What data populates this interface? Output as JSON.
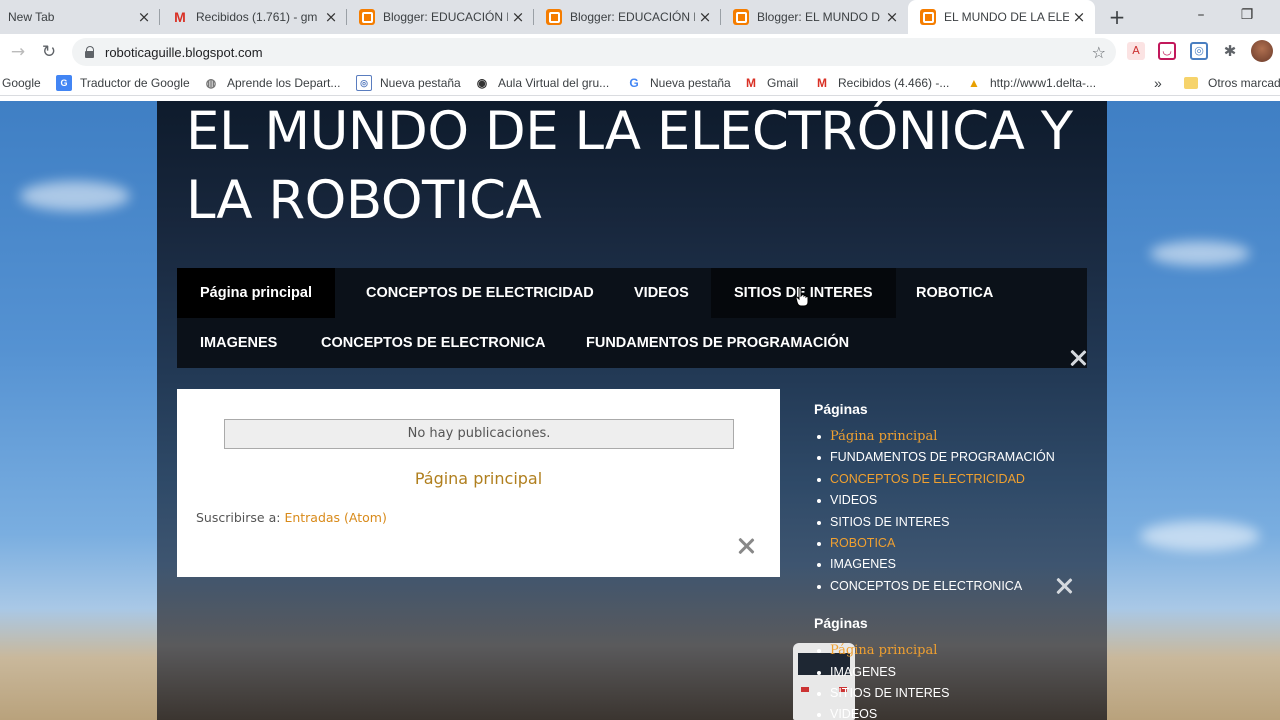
{
  "browser": {
    "tabs": [
      {
        "title": "New Tab",
        "favicon": "none"
      },
      {
        "title": "Recibidos (1.761) - gm",
        "favicon": "gmail-icon"
      },
      {
        "title": "Blogger: EDUCACIÓN D",
        "favicon": "blogger-icon"
      },
      {
        "title": "Blogger: EDUCACIÓN D",
        "favicon": "blogger-icon"
      },
      {
        "title": "Blogger: EL MUNDO D",
        "favicon": "blogger-icon"
      },
      {
        "title": "EL MUNDO DE LA ELEC",
        "favicon": "blogger-icon",
        "active": true
      }
    ],
    "new_tab": "+",
    "close_glyph": "×",
    "window_controls": {
      "minimize": "–",
      "restore": "❐"
    },
    "url": "roboticaguille.blogspot.com",
    "bookmarks": [
      {
        "label": "Google",
        "icon": "none"
      },
      {
        "label": "Traductor de Google",
        "icon": "translate-icon"
      },
      {
        "label": "Aprende los Depart...",
        "icon": "globe-icon"
      },
      {
        "label": "Nueva pestaña",
        "icon": "newtab-icon"
      },
      {
        "label": "Aula Virtual del gru...",
        "icon": "globe-icon"
      },
      {
        "label": "Nueva pestaña",
        "icon": "google-icon"
      },
      {
        "label": "Gmail",
        "icon": "gmail-icon"
      },
      {
        "label": "Recibidos (4.466) -...",
        "icon": "gmail-icon"
      },
      {
        "label": "http://www1.delta-...",
        "icon": "delta-icon"
      }
    ],
    "more_bookmarks": "»",
    "other_bookmarks": "Otros marcad"
  },
  "blog": {
    "title": "EL MUNDO DE LA ELECTRONICA Y LA ROBOTICA",
    "title_line1": "EL MUNDO DE LA ELECTRÓNICA Y",
    "title_line2": "LA ROBOTICA",
    "nav": [
      "Página principal",
      "CONCEPTOS DE ELECTRICIDAD",
      "VIDEOS",
      "SITIOS DE INTERES",
      "ROBOTICA",
      "IMAGENES",
      "CONCEPTOS DE ELECTRONICA",
      "FUNDAMENTOS DE PROGRAMACIÓN"
    ],
    "main": {
      "no_posts": "No hay publicaciones.",
      "home_link": "Página principal",
      "subscribe_label": "Suscribirse a:",
      "subscribe_link": "Entradas (Atom)"
    },
    "sidebar": [
      {
        "heading": "Páginas",
        "items": [
          "Página principal",
          "FUNDAMENTOS DE PROGRAMACIÓN",
          "CONCEPTOS DE ELECTRICIDAD",
          "VIDEOS",
          "SITIOS DE INTERES",
          "ROBOTICA",
          "IMAGENES",
          "CONCEPTOS DE ELECTRONICA"
        ]
      },
      {
        "heading": "Páginas",
        "items": [
          "Página principal",
          "IMAGENES",
          "SITIOS DE INTERES",
          "VIDEOS"
        ]
      }
    ]
  },
  "colors": {
    "accent_link": "#f0a030",
    "home_link": "#b07f1e",
    "nav_bar": "#0b1119",
    "tabstrip": "#dee1e6"
  }
}
